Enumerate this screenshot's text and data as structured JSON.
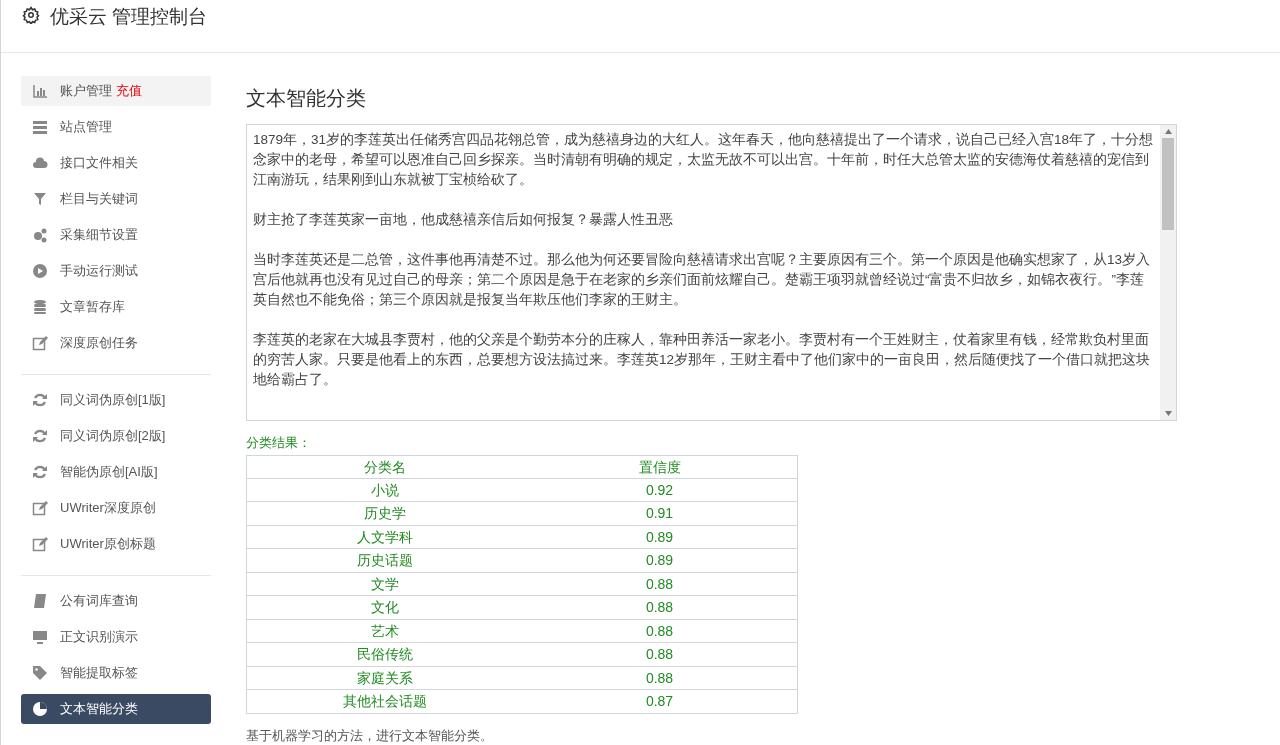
{
  "header": {
    "title": "优采云 管理控制台"
  },
  "sidebar": {
    "groups": [
      {
        "items": [
          {
            "label": "账户管理",
            "badge": "充值",
            "selected": false,
            "hover": true
          },
          {
            "label": "站点管理",
            "selected": false,
            "hover": false
          },
          {
            "label": "接口文件相关",
            "selected": false,
            "hover": false
          },
          {
            "label": "栏目与关键词",
            "selected": false,
            "hover": false
          },
          {
            "label": "采集细节设置",
            "selected": false,
            "hover": false
          },
          {
            "label": "手动运行测试",
            "selected": false,
            "hover": false
          },
          {
            "label": "文章暂存库",
            "selected": false,
            "hover": false
          },
          {
            "label": "深度原创任务",
            "selected": false,
            "hover": false
          }
        ]
      },
      {
        "items": [
          {
            "label": "同义词伪原创[1版]",
            "selected": false,
            "hover": false
          },
          {
            "label": "同义词伪原创[2版]",
            "selected": false,
            "hover": false
          },
          {
            "label": "智能伪原创[AI版]",
            "selected": false,
            "hover": false
          },
          {
            "label": "UWriter深度原创",
            "selected": false,
            "hover": false
          },
          {
            "label": "UWriter原创标题",
            "selected": false,
            "hover": false
          }
        ]
      },
      {
        "items": [
          {
            "label": "公有词库查询",
            "selected": false,
            "hover": false
          },
          {
            "label": "正文识别演示",
            "selected": false,
            "hover": false
          },
          {
            "label": "智能提取标签",
            "selected": false,
            "hover": false
          },
          {
            "label": "文本智能分类",
            "selected": true,
            "hover": false
          }
        ]
      }
    ]
  },
  "main": {
    "title": "文本智能分类",
    "text_input": {
      "paragraphs": [
        "1879年，31岁的李莲英出任储秀宫四品花翎总管，成为慈禧身边的大红人。这年春天，他向慈禧提出了一个请求，说自己已经入宫18年了，十分想念家中的老母，希望可以恩准自己回乡探亲。当时清朝有明确的规定，太监无故不可以出宫。十年前，时任大总管太监的安德海仗着慈禧的宠信到江南游玩，结果刚到山东就被丁宝桢给砍了。",
        "财主抢了李莲英家一亩地，他成慈禧亲信后如何报复？暴露人性丑恶",
        "当时李莲英还是二总管，这件事他再清楚不过。那么他为何还要冒险向慈禧请求出宫呢？主要原因有三个。第一个原因是他确实想家了，从13岁入宫后他就再也没有见过自己的母亲；第二个原因是急于在老家的乡亲们面前炫耀自己。楚霸王项羽就曾经说过“富贵不归故乡，如锦衣夜行。”李莲英自然也不能免俗；第三个原因就是报复当年欺压他们李家的王财主。",
        "李莲英的老家在大城县李贾村，他的父亲是个勤劳本分的庄稼人，靠种田养活一家老小。李贾村有一个王姓财主，仗着家里有钱，经常欺负村里面的穷苦人家。只要是他看上的东西，总要想方设法搞过来。李莲英12岁那年，王财主看中了他们家中的一亩良田，然后随便找了一个借口就把这块地给霸占了。"
      ]
    },
    "result_label": "分类结果：",
    "table": {
      "columns": [
        "分类名",
        "置信度"
      ],
      "rows": [
        [
          "小说",
          "0.92"
        ],
        [
          "历史学",
          "0.91"
        ],
        [
          "人文学科",
          "0.89"
        ],
        [
          "历史话题",
          "0.89"
        ],
        [
          "文学",
          "0.88"
        ],
        [
          "文化",
          "0.88"
        ],
        [
          "艺术",
          "0.88"
        ],
        [
          "民俗传统",
          "0.88"
        ],
        [
          "家庭关系",
          "0.88"
        ],
        [
          "其他社会话题",
          "0.87"
        ]
      ]
    },
    "note": "基于机器学习的方法，进行文本智能分类。"
  }
}
